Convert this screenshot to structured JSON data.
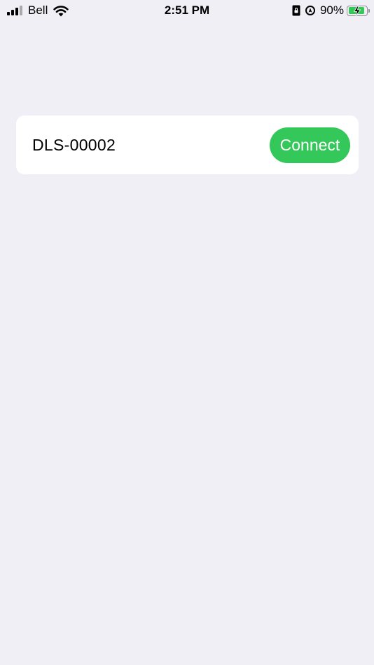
{
  "status_bar": {
    "carrier": "Bell",
    "time": "2:51 PM",
    "battery_percent_label": "90%",
    "battery_level": 0.9,
    "icons": [
      "signal-icon",
      "wifi-icon",
      "portrait-lock-icon",
      "location-icon",
      "battery-charging-icon"
    ]
  },
  "device": {
    "name": "DLS-00002",
    "connect_label": "Connect"
  },
  "colors": {
    "background": "#f0eff5",
    "card": "#ffffff",
    "accent_green": "#34c759"
  }
}
